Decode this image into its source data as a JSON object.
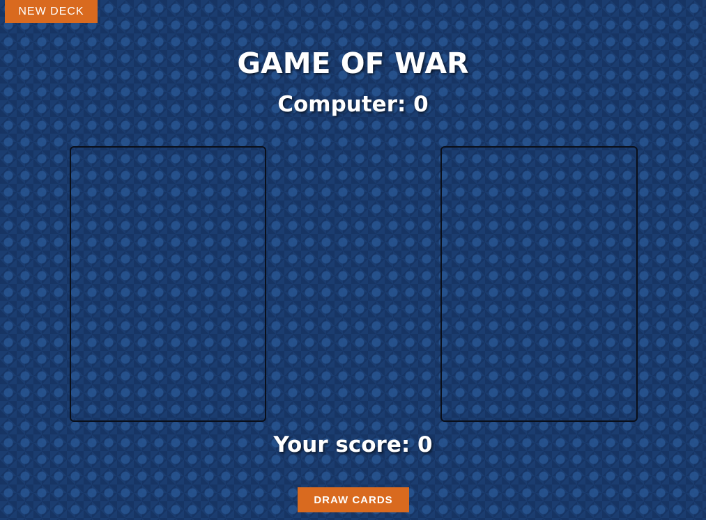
{
  "toolbar": {
    "new_deck_label": "NEW DECK"
  },
  "game": {
    "title": "GAME OF WAR",
    "computer_label": "Computer: 0",
    "player_label": "Your score: 0",
    "computer_score": 0,
    "player_score": 0
  },
  "actions": {
    "draw_cards_label": "DRAW CARDS"
  },
  "colors": {
    "background": "#1b3d70",
    "button": "#d96a1f",
    "text": "#ffffff"
  }
}
